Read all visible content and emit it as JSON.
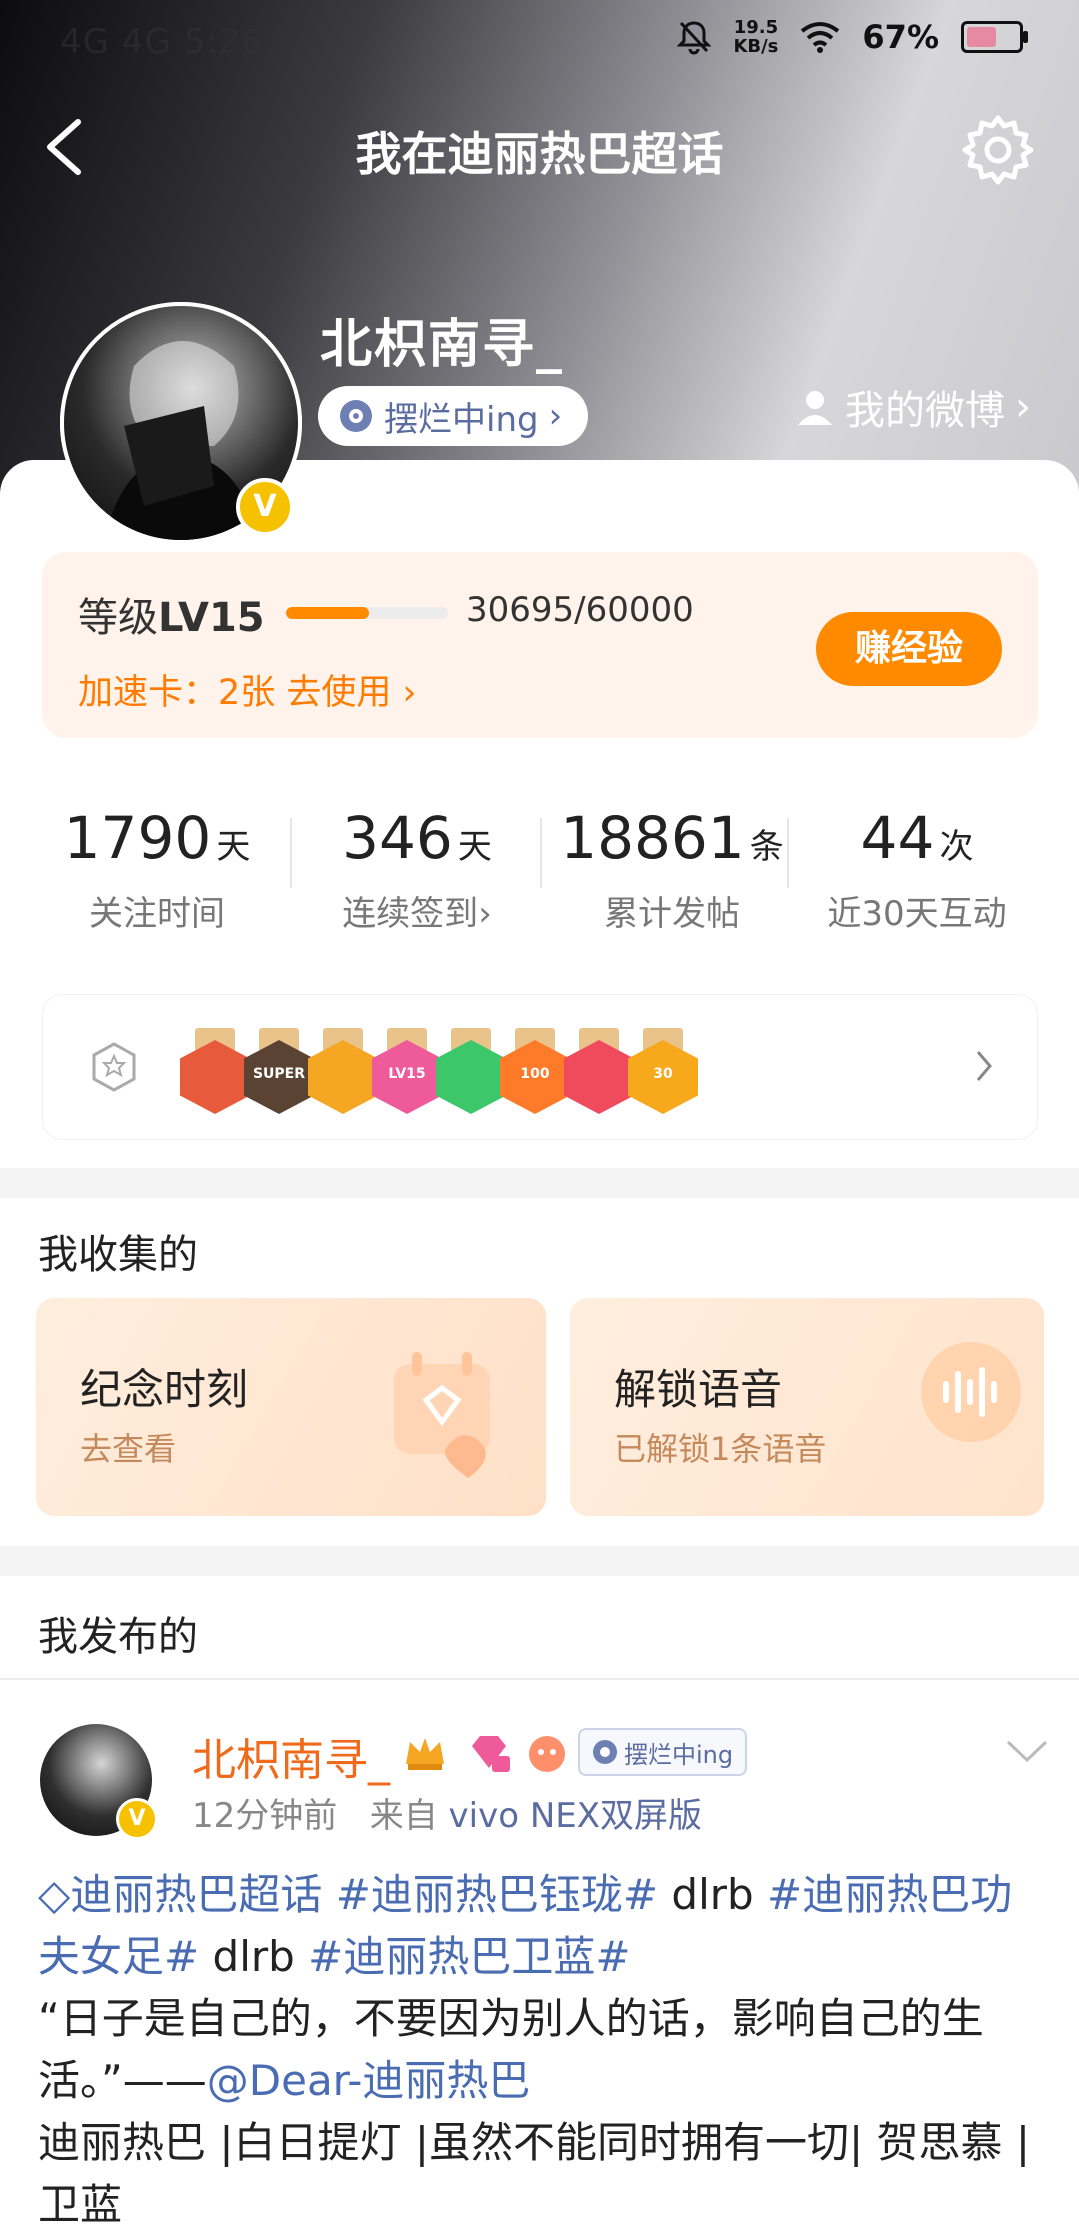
{
  "status_bar": {
    "left": "4G 4G 5:26",
    "speed": "19.5",
    "speed_unit": "KB/s",
    "battery_pct": "67%",
    "battery_level": 0.67
  },
  "header": {
    "title": "我在迪丽热巴超话"
  },
  "profile": {
    "username": "北枳南寻_",
    "status": "摆烂中ing",
    "my_weibo": "我的微博",
    "verified": "V"
  },
  "level": {
    "label_prefix": "等级",
    "level": "LV15",
    "exp": "30695/60000",
    "progress": 0.51,
    "speed_card": "加速卡：2张 去使用",
    "earn_button": "赚经验"
  },
  "stats": [
    {
      "value": "1790",
      "unit": "天",
      "label": "关注时间"
    },
    {
      "value": "346",
      "unit": "天",
      "label": "连续签到"
    },
    {
      "value": "18861",
      "unit": "条",
      "label": "累计发帖"
    },
    {
      "value": "44",
      "unit": "次",
      "label": "近30天互动"
    }
  ],
  "badges": [
    {
      "name": "badge-red",
      "color": "#e85a3c",
      "text": ""
    },
    {
      "name": "badge-super",
      "color": "#5a4332",
      "text": "SUPER"
    },
    {
      "name": "badge-crown",
      "color": "#f5a623",
      "text": ""
    },
    {
      "name": "badge-lv15",
      "color": "#ef5b9a",
      "text": "LV15"
    },
    {
      "name": "badge-hand",
      "color": "#3cc76a",
      "text": ""
    },
    {
      "name": "badge-100days",
      "color": "#ff7a29",
      "text": "100"
    },
    {
      "name": "badge-trophy",
      "color": "#ef4b5d",
      "text": ""
    },
    {
      "name": "badge-30days",
      "color": "#f7a81b",
      "text": "30"
    }
  ],
  "collected": {
    "title": "我收集的",
    "items": [
      {
        "title": "纪念时刻",
        "subtitle": "去查看"
      },
      {
        "title": "解锁语音",
        "subtitle": "已解锁1条语音"
      }
    ]
  },
  "published": {
    "title": "我发布的",
    "post": {
      "author": "北枳南寻_",
      "status": "摆烂中ing",
      "time": "12分钟前",
      "from_prefix": "来自",
      "source": "vivo NEX双屏版",
      "tag1": "迪丽热巴超话",
      "tag2": "#迪丽热巴钰珑#",
      "word1": " dlrb ",
      "tag3": "#迪丽热巴功夫女足#",
      "word2": " dlrb ",
      "tag4": "#迪丽热巴卫蓝#",
      "quote": "“日子是自己的，不要因为别人的话，影响自己的生活。”——",
      "mention": "@Dear-迪丽热巴",
      "tail": "迪丽热巴 |白日提灯 |虽然不能同时拥有一切| 贺思慕 | 卫蓝"
    }
  }
}
